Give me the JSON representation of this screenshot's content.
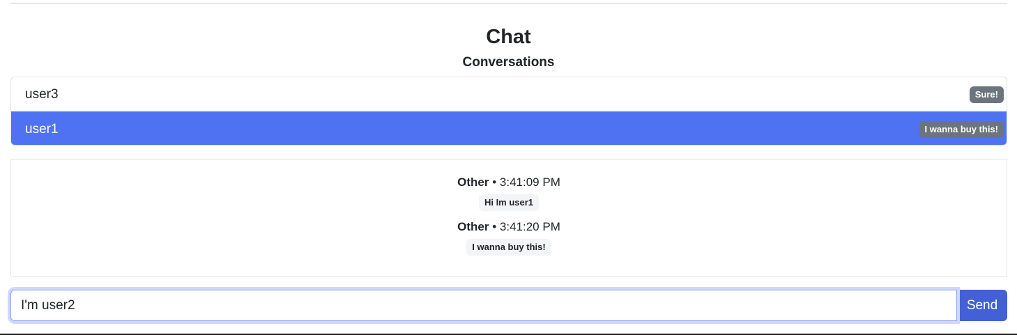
{
  "header": {
    "title": "Chat",
    "subtitle": "Conversations"
  },
  "conversations": [
    {
      "name": "user3",
      "last_message": "Sure!",
      "active": false
    },
    {
      "name": "user1",
      "last_message": "I wanna buy this!",
      "active": true
    }
  ],
  "messages": [
    {
      "sender": "Other",
      "separator": "•",
      "time": "3:41:09 PM",
      "text": "Hi Im user1"
    },
    {
      "sender": "Other",
      "separator": "•",
      "time": "3:41:20 PM",
      "text": "I wanna buy this!"
    }
  ],
  "composer": {
    "value": "I'm user2",
    "send_label": "Send"
  },
  "colors": {
    "active_item": "#4f72f2",
    "badge": "#6c757d",
    "send_button": "#4360d6"
  }
}
